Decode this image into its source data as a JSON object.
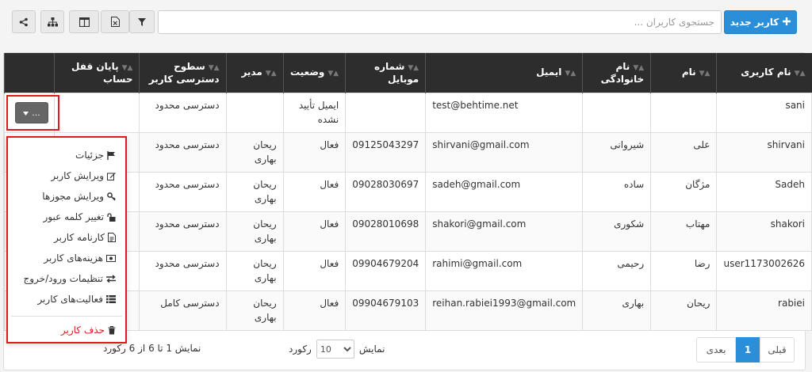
{
  "toolbar": {
    "new_user_label": "کاربر جدید",
    "search_placeholder": "جستجوی کاربران ..."
  },
  "columns": [
    {
      "label": "نام کاربری"
    },
    {
      "label": "نام"
    },
    {
      "label": "نام خانوادگی"
    },
    {
      "label": "ایمیل"
    },
    {
      "label": "شماره موبایل"
    },
    {
      "label": "وضعیت"
    },
    {
      "label": "مدیر"
    },
    {
      "label": "سطوح دسترسی کاربر"
    },
    {
      "label": "پایان قفل حساب"
    },
    {
      "label": ""
    }
  ],
  "rows": [
    {
      "username": "sani",
      "first": "",
      "last": "",
      "email": "test@behtime.net",
      "mobile": "",
      "status": "ایمیل تأیید نشده",
      "manager": "",
      "access": "دسترسی محدود",
      "lock_end": ""
    },
    {
      "username": "shirvani",
      "first": "علی",
      "last": "شیروانی",
      "email": "shirvani@gmail.com",
      "mobile": "09125043297",
      "status": "فعال",
      "manager": "ریحان بهاری",
      "access": "دسترسی محدود",
      "lock_end": ""
    },
    {
      "username": "Sadeh",
      "first": "مژگان",
      "last": "ساده",
      "email": "sadeh@gmail.com",
      "mobile": "09028030697",
      "status": "فعال",
      "manager": "ریحان بهاری",
      "access": "دسترسی محدود",
      "lock_end": ""
    },
    {
      "username": "shakori",
      "first": "مهتاب",
      "last": "شکوری",
      "email": "shakori@gmail.com",
      "mobile": "09028010698",
      "status": "فعال",
      "manager": "ریحان بهاری",
      "access": "دسترسی محدود",
      "lock_end": ""
    },
    {
      "username": "user1173002626",
      "first": "رضا",
      "last": "رحیمی",
      "email": "rahimi@gmail.com",
      "mobile": "09904679204",
      "status": "فعال",
      "manager": "ریحان بهاری",
      "access": "دسترسی محدود",
      "lock_end": ""
    },
    {
      "username": "rabiei",
      "first": "ریحان",
      "last": "بهاری",
      "email": "reihan.rabiei1993@gmail.com",
      "mobile": "09904679103",
      "status": "فعال",
      "manager": "ریحان بهاری",
      "access": "دسترسی کامل",
      "lock_end": ""
    }
  ],
  "row_action_label": "...",
  "menu": {
    "items": [
      {
        "label": "جزئیات",
        "icon": "flag-icon"
      },
      {
        "label": "ویرایش کاربر",
        "icon": "edit-icon"
      },
      {
        "label": "ویرایش مجوزها",
        "icon": "key-icon"
      },
      {
        "label": "تغییر کلمه عبور",
        "icon": "unlock-icon"
      },
      {
        "label": "کارنامه کاربر",
        "icon": "file-icon"
      },
      {
        "label": "هزینه‌های کاربر",
        "icon": "money-icon"
      },
      {
        "label": "تنظیمات ورود/خروج",
        "icon": "exchange-icon"
      },
      {
        "label": "فعالیت‌های کاربر",
        "icon": "list-icon"
      }
    ],
    "delete_label": "حذف کاربر",
    "danger_color": "#e0191f"
  },
  "pagination": {
    "prev_label": "قبلی",
    "current_page": "1",
    "next_label": "بعدی"
  },
  "page_size": {
    "show_label": "نمایش",
    "value": "10",
    "unit_label": "رکورد"
  },
  "summary": "نمایش 1 تا 6 از 6 رکورد",
  "colors": {
    "primary": "#2a8ed8",
    "header_bg": "#2d2d2d",
    "highlight": "#e0191f"
  }
}
